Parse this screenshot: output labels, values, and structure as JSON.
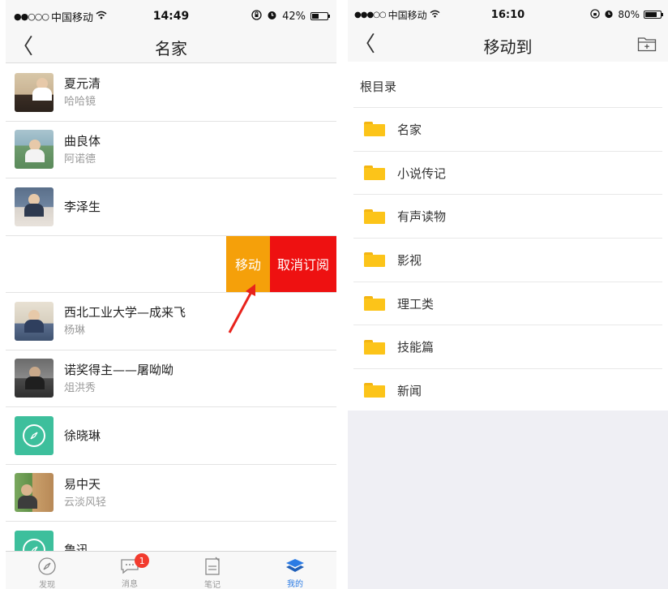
{
  "left": {
    "status": {
      "signal_dots": "●●○○○",
      "carrier": "中国移动",
      "time": "14:49",
      "battery": "42%",
      "battery_fill": 0.42
    },
    "nav": {
      "back": "〈",
      "title": "名家"
    },
    "rows": [
      {
        "name": "夏元清",
        "sub": "哈哈镜"
      },
      {
        "name": "曲良体",
        "sub": "阿诺德"
      },
      {
        "name": "李泽生",
        "sub": ""
      }
    ],
    "swipe": {
      "move": "移动",
      "unsubscribe": "取消订阅"
    },
    "rows2": [
      {
        "name": "西北工业大学—成来飞",
        "sub": "杨琳"
      },
      {
        "name": "诺奖得主——屠呦呦",
        "sub": "俎洪秀"
      },
      {
        "name": "徐晓琳",
        "sub": ""
      },
      {
        "name": "易中天",
        "sub": "云淡风轻"
      },
      {
        "name": "鲁迅",
        "sub": ""
      }
    ],
    "tabs": [
      {
        "label": "发现",
        "icon": "compass-icon"
      },
      {
        "label": "消息",
        "icon": "chat-icon",
        "badge": "1"
      },
      {
        "label": "笔记",
        "icon": "note-icon"
      },
      {
        "label": "我的",
        "icon": "stack-icon"
      }
    ],
    "colors": {
      "move": "#f5a00a",
      "unsubscribe": "#ee1111",
      "active_tab": "#2b7be4",
      "arrow": "#e8231c"
    }
  },
  "right": {
    "status": {
      "signal_dots": "●●●○○",
      "carrier": "中国移动",
      "time": "16:10",
      "battery": "80%",
      "battery_fill": 0.8
    },
    "nav": {
      "back": "〈",
      "title": "移动到"
    },
    "root": "根目录",
    "folders": [
      "名家",
      "小说传记",
      "有声读物",
      "影视",
      "理工类",
      "技能篇",
      "新闻"
    ],
    "colors": {
      "folder": "#fcc419"
    }
  }
}
